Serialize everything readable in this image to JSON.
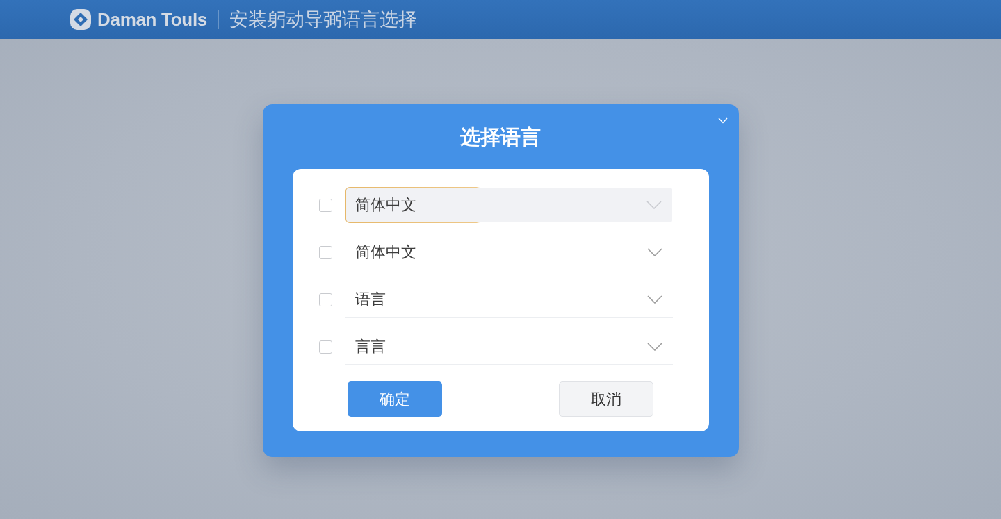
{
  "header": {
    "brand": "Daman Touls",
    "subtitle": "安装躬动导弼语言选择"
  },
  "dialog": {
    "title": "选择语言",
    "options": [
      {
        "value": "简体中文",
        "checked": false,
        "focused": true
      },
      {
        "value": "简体中文",
        "checked": false,
        "focused": false
      },
      {
        "value": "语言",
        "checked": false,
        "focused": false
      },
      {
        "value": "言言",
        "checked": false,
        "focused": false
      }
    ],
    "buttons": [
      {
        "label": "确定",
        "kind": "primary"
      },
      {
        "label": "取消",
        "kind": "secondary"
      }
    ]
  }
}
